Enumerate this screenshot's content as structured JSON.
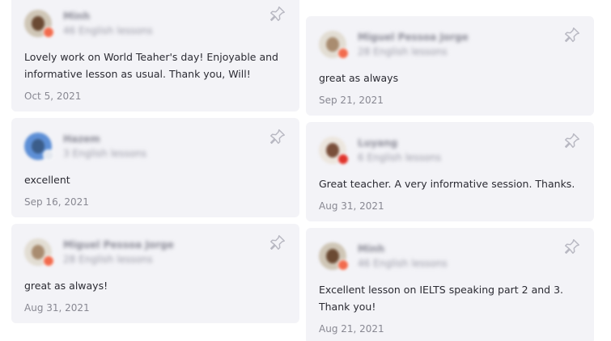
{
  "reviews_left": [
    {
      "name": "Minh",
      "lessons": "46 English lessons",
      "text": "Lovely work on World Teaher's day! Enjoyable and informative lesson as usual. Thank you, Will!",
      "date": "Oct 5, 2021"
    },
    {
      "name": "Hazem",
      "lessons": "3 English lessons",
      "text": "excellent",
      "date": "Sep 16, 2021"
    },
    {
      "name": "Miguel Pessoa Jorge",
      "lessons": "28 English lessons",
      "text": "great as always!",
      "date": "Aug 31, 2021"
    }
  ],
  "reviews_right": [
    {
      "name": "Miguel Pessoa Jorge",
      "lessons": "28 English lessons",
      "text": "great as always",
      "date": "Sep 21, 2021"
    },
    {
      "name": "Luyang",
      "lessons": "6 English lessons",
      "text": "Great teacher. A very informative session. Thanks.",
      "date": "Aug 31, 2021"
    },
    {
      "name": "Minh",
      "lessons": "46 English lessons",
      "text": "Excellent lesson on IELTS speaking part 2 and 3. Thank you!",
      "date": "Aug 21, 2021"
    }
  ],
  "colors": {
    "card_background": "#f3f3f7",
    "flag_badge": "#f26b4d",
    "pin_icon": "#b8b8c2"
  }
}
